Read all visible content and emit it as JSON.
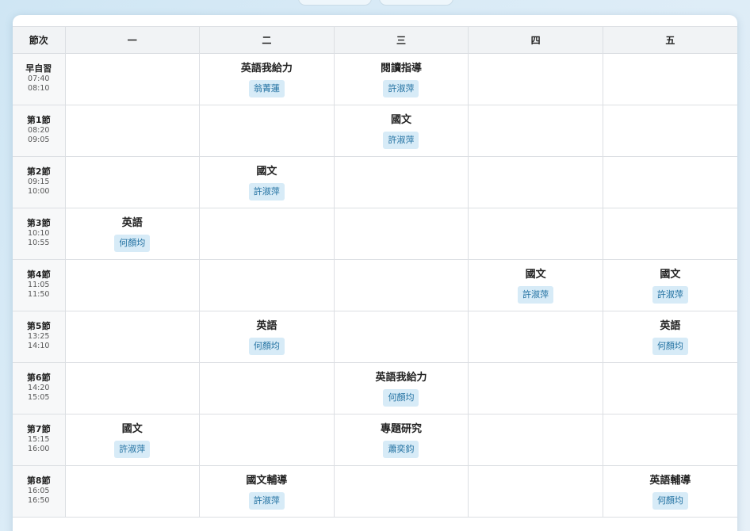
{
  "header": {
    "period_label": "節次",
    "days": [
      "一",
      "二",
      "三",
      "四",
      "五"
    ]
  },
  "periods": [
    {
      "name": "早自習",
      "start": "07:40",
      "end": "08:10",
      "cells": [
        {
          "subject": "",
          "teacher": ""
        },
        {
          "subject": "英語我給力",
          "teacher": "翁菁蓮"
        },
        {
          "subject": "閱讀指導",
          "teacher": "許淑萍"
        },
        {
          "subject": "",
          "teacher": ""
        },
        {
          "subject": "",
          "teacher": ""
        }
      ]
    },
    {
      "name": "第1節",
      "start": "08:20",
      "end": "09:05",
      "cells": [
        {
          "subject": "",
          "teacher": ""
        },
        {
          "subject": "",
          "teacher": ""
        },
        {
          "subject": "國文",
          "teacher": "許淑萍"
        },
        {
          "subject": "",
          "teacher": ""
        },
        {
          "subject": "",
          "teacher": ""
        }
      ]
    },
    {
      "name": "第2節",
      "start": "09:15",
      "end": "10:00",
      "cells": [
        {
          "subject": "",
          "teacher": ""
        },
        {
          "subject": "國文",
          "teacher": "許淑萍"
        },
        {
          "subject": "",
          "teacher": ""
        },
        {
          "subject": "",
          "teacher": ""
        },
        {
          "subject": "",
          "teacher": ""
        }
      ]
    },
    {
      "name": "第3節",
      "start": "10:10",
      "end": "10:55",
      "cells": [
        {
          "subject": "英語",
          "teacher": "何顏均"
        },
        {
          "subject": "",
          "teacher": ""
        },
        {
          "subject": "",
          "teacher": ""
        },
        {
          "subject": "",
          "teacher": ""
        },
        {
          "subject": "",
          "teacher": ""
        }
      ]
    },
    {
      "name": "第4節",
      "start": "11:05",
      "end": "11:50",
      "cells": [
        {
          "subject": "",
          "teacher": ""
        },
        {
          "subject": "",
          "teacher": ""
        },
        {
          "subject": "",
          "teacher": ""
        },
        {
          "subject": "國文",
          "teacher": "許淑萍"
        },
        {
          "subject": "國文",
          "teacher": "許淑萍"
        }
      ]
    },
    {
      "name": "第5節",
      "start": "13:25",
      "end": "14:10",
      "cells": [
        {
          "subject": "",
          "teacher": ""
        },
        {
          "subject": "英語",
          "teacher": "何顏均"
        },
        {
          "subject": "",
          "teacher": ""
        },
        {
          "subject": "",
          "teacher": ""
        },
        {
          "subject": "英語",
          "teacher": "何顏均"
        }
      ]
    },
    {
      "name": "第6節",
      "start": "14:20",
      "end": "15:05",
      "cells": [
        {
          "subject": "",
          "teacher": ""
        },
        {
          "subject": "",
          "teacher": ""
        },
        {
          "subject": "英語我給力",
          "teacher": "何顏均"
        },
        {
          "subject": "",
          "teacher": ""
        },
        {
          "subject": "",
          "teacher": ""
        }
      ]
    },
    {
      "name": "第7節",
      "start": "15:15",
      "end": "16:00",
      "cells": [
        {
          "subject": "國文",
          "teacher": "許淑萍"
        },
        {
          "subject": "",
          "teacher": ""
        },
        {
          "subject": "專題研究",
          "teacher": "蕭奕鈞"
        },
        {
          "subject": "",
          "teacher": ""
        },
        {
          "subject": "",
          "teacher": ""
        }
      ]
    },
    {
      "name": "第8節",
      "start": "16:05",
      "end": "16:50",
      "cells": [
        {
          "subject": "",
          "teacher": ""
        },
        {
          "subject": "國文輔導",
          "teacher": "許淑萍"
        },
        {
          "subject": "",
          "teacher": ""
        },
        {
          "subject": "",
          "teacher": ""
        },
        {
          "subject": "英語輔導",
          "teacher": "何顏均"
        }
      ]
    }
  ]
}
